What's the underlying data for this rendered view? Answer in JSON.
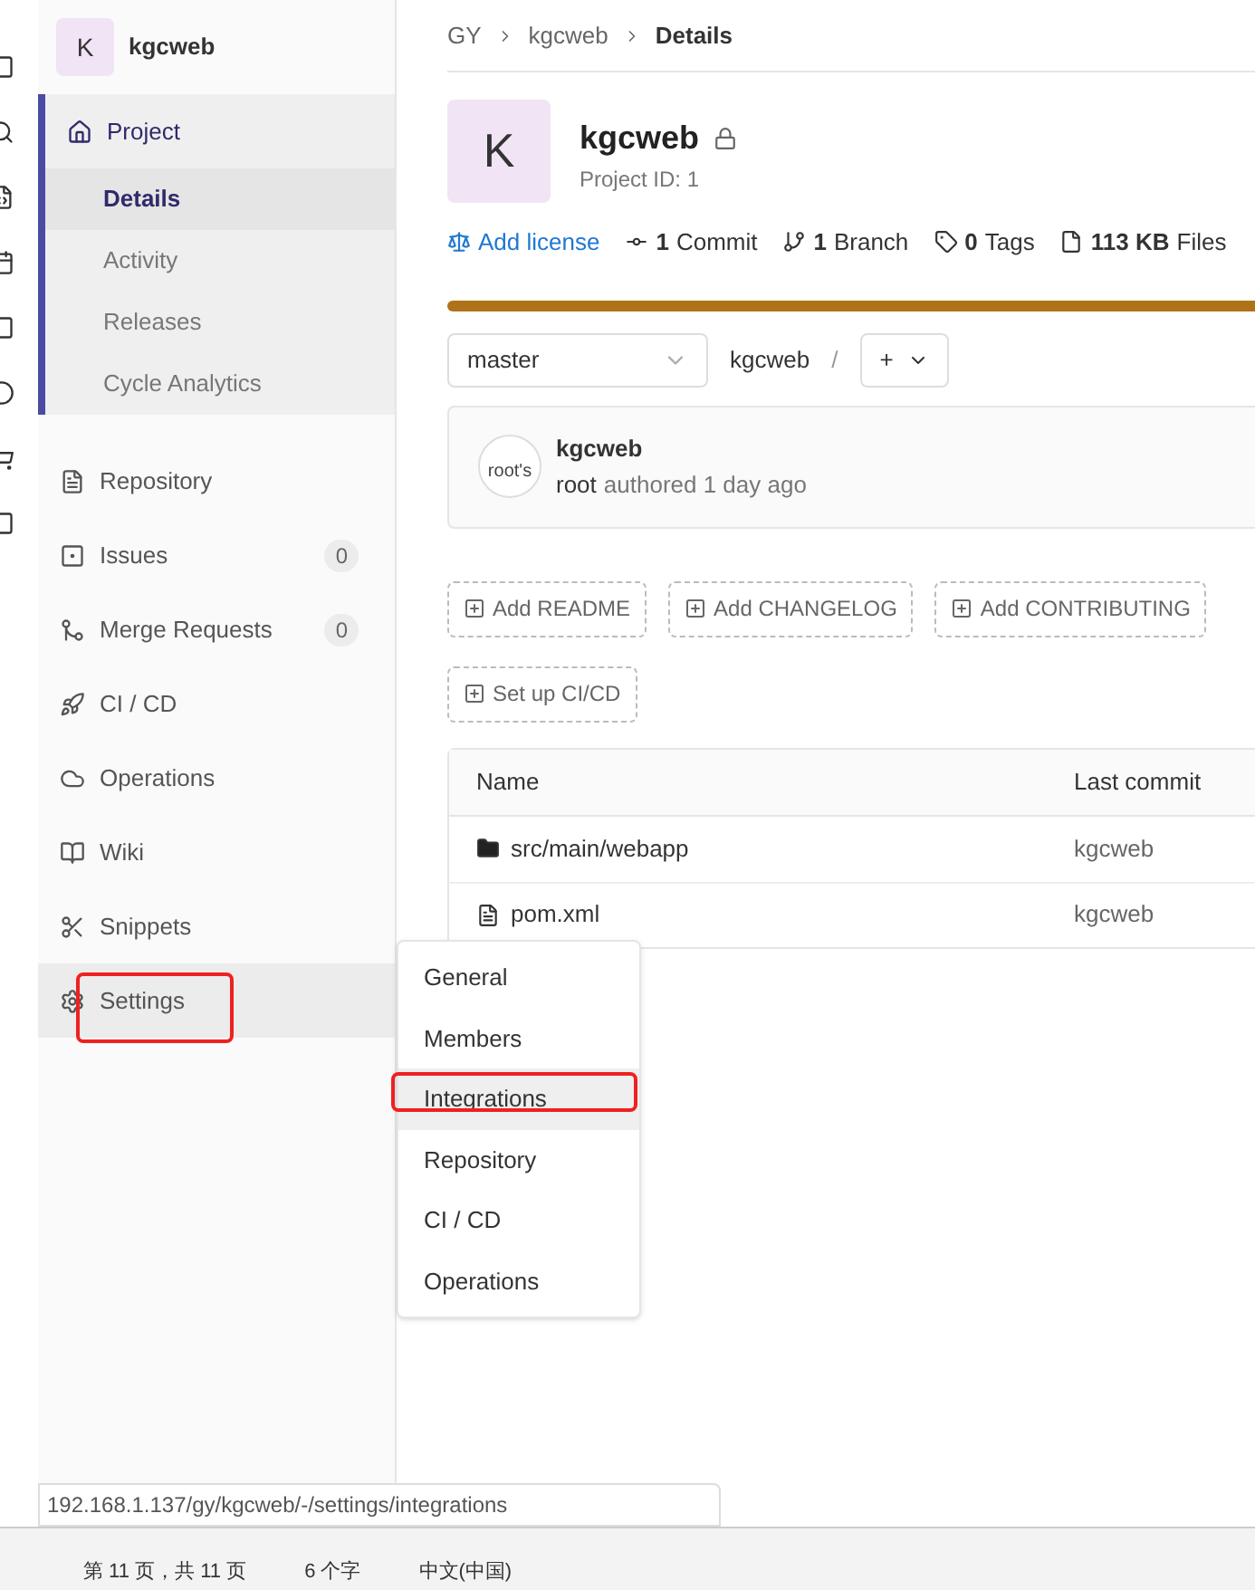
{
  "project": {
    "letter": "K",
    "name": "kgcweb"
  },
  "sidebar": {
    "items": [
      {
        "kind": "home",
        "label": "Project",
        "selected": true,
        "children": [
          {
            "label": "Details",
            "selected": true
          },
          {
            "label": "Activity",
            "selected": false
          },
          {
            "label": "Releases",
            "selected": false
          },
          {
            "label": "Cycle Analytics",
            "selected": false
          }
        ]
      },
      {
        "kind": "doc",
        "label": "Repository",
        "selected": false
      },
      {
        "kind": "issues",
        "label": "Issues",
        "count": "0",
        "selected": false
      },
      {
        "kind": "merge",
        "label": "Merge Requests",
        "count": "0",
        "selected": false
      },
      {
        "kind": "rocket",
        "label": "CI / CD",
        "selected": false
      },
      {
        "kind": "cloud",
        "label": "Operations",
        "selected": false
      },
      {
        "kind": "book",
        "label": "Wiki",
        "selected": false
      },
      {
        "kind": "scissors",
        "label": "Snippets",
        "selected": false
      },
      {
        "kind": "gear",
        "label": "Settings",
        "selected": true,
        "highlighted": true
      }
    ]
  },
  "flyout": [
    {
      "label": "General",
      "selected": false,
      "highlighted": false
    },
    {
      "label": "Members",
      "selected": false,
      "highlighted": false
    },
    {
      "label": "Integrations",
      "selected": true,
      "highlighted": true
    },
    {
      "label": "Repository",
      "selected": false,
      "highlighted": false
    },
    {
      "label": "CI / CD",
      "selected": false,
      "highlighted": false
    },
    {
      "label": "Operations",
      "selected": false,
      "highlighted": false
    }
  ],
  "breadcrumb": [
    "GY",
    "kgcweb",
    "Details"
  ],
  "header": {
    "letter": "K",
    "title": "kgcweb",
    "project_id": "Project ID: 1"
  },
  "stats": [
    {
      "kind": "license",
      "label": "Add license"
    },
    {
      "kind": "commit",
      "count": "1",
      "label": "Commit"
    },
    {
      "kind": "branch",
      "count": "1",
      "label": "Branch"
    },
    {
      "kind": "tag",
      "count": "0",
      "label": "Tags"
    },
    {
      "kind": "file",
      "count": "113 KB",
      "label": "Files"
    }
  ],
  "branch": {
    "value": "master",
    "path": "kgcweb",
    "separator": "/",
    "add": "+"
  },
  "commit": {
    "avatar_alt": "root's",
    "title": "kgcweb",
    "author": "root",
    "meta": "authored 1 day ago"
  },
  "actions": [
    "Add README",
    "Add CHANGELOG",
    "Add CONTRIBUTING",
    "Set up CI/CD"
  ],
  "table": {
    "columns": [
      "Name",
      "Last commit"
    ],
    "rows": [
      {
        "kind": "folder",
        "name": "src/main/webapp",
        "last_commit": "kgcweb"
      },
      {
        "kind": "file",
        "name": "pom.xml",
        "last_commit": "kgcweb"
      }
    ]
  },
  "url_tooltip": "192.168.1.137/gy/kgcweb/-/settings/integrations",
  "status_bar": [
    "第 11 页，共 11 页",
    "6 个字",
    "中文(中国)"
  ]
}
